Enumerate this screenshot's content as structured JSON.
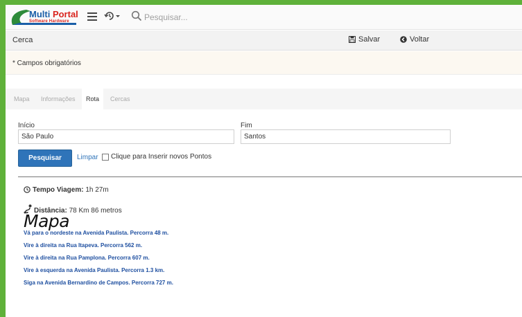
{
  "header": {
    "logo": {
      "brand_part1": "Multi",
      "brand_part2": " Portal",
      "tagline": "Software Hardware"
    },
    "search": {
      "placeholder": "Pesquisar..."
    },
    "icons": [
      "menu-icon",
      "history-icon",
      "search-icon"
    ]
  },
  "titlebar": {
    "title": "Cerca",
    "save_label": "Salvar",
    "back_label": "Voltar"
  },
  "alert": {
    "text": "* Campos obrigatórios"
  },
  "tabs": [
    {
      "label": "Mapa",
      "active": false
    },
    {
      "label": "Informações",
      "active": false
    },
    {
      "label": "Rota",
      "active": true
    },
    {
      "label": "Cercas",
      "active": false
    }
  ],
  "form": {
    "start": {
      "label": "Início",
      "value": "São Paulo"
    },
    "end": {
      "label": "Fim",
      "value": "Santos"
    },
    "search_button": "Pesquisar",
    "clear_link": "Limpar",
    "checkbox_label": "Clique para Inserir novos Pontos"
  },
  "result": {
    "time_label": "Tempo Viagem:",
    "time_value": " 1h 27m",
    "distance_label": "Distância:",
    "distance_value": " 78 Km 86 metros",
    "map_title": "Mapa",
    "steps": [
      "Vá para o nordeste na Avenida Paulista. Percorra 48 m.",
      "Vire à direita na Rua Itapeva. Percorra 562 m.",
      "Vire à direita na Rua Pamplona. Percorra 607 m.",
      "Vire à esquerda na Avenida Paulista. Percorra 1.3 km.",
      "Siga na Avenida Bernardino de Campos. Percorra 727 m."
    ]
  },
  "colors": {
    "frame": "#5fb13a",
    "primary": "#2f74b9",
    "link": "#1e4fa0",
    "alert_bg": "#fcf8f1"
  }
}
